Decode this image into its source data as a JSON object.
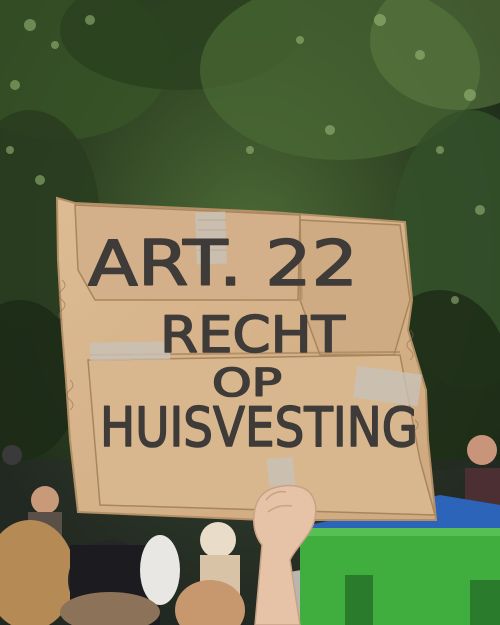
{
  "sign": {
    "line1": "ART. 22",
    "line2": "RECHT",
    "line3": "OP",
    "line4": "HUISVESTING"
  },
  "colors": {
    "foliage_dark": "#1e2b1b",
    "foliage_mid": "#3d5a2c",
    "foliage_light": "#8aa86a",
    "cardboard": "#d7b48a",
    "cardboard_shadow": "#bf9a70",
    "tape": "#c9c2b8",
    "marker": "#3e3b38",
    "green_structure": "#3fae3e",
    "blue_roof": "#2b64b8",
    "skin": "#e6c3a6"
  }
}
